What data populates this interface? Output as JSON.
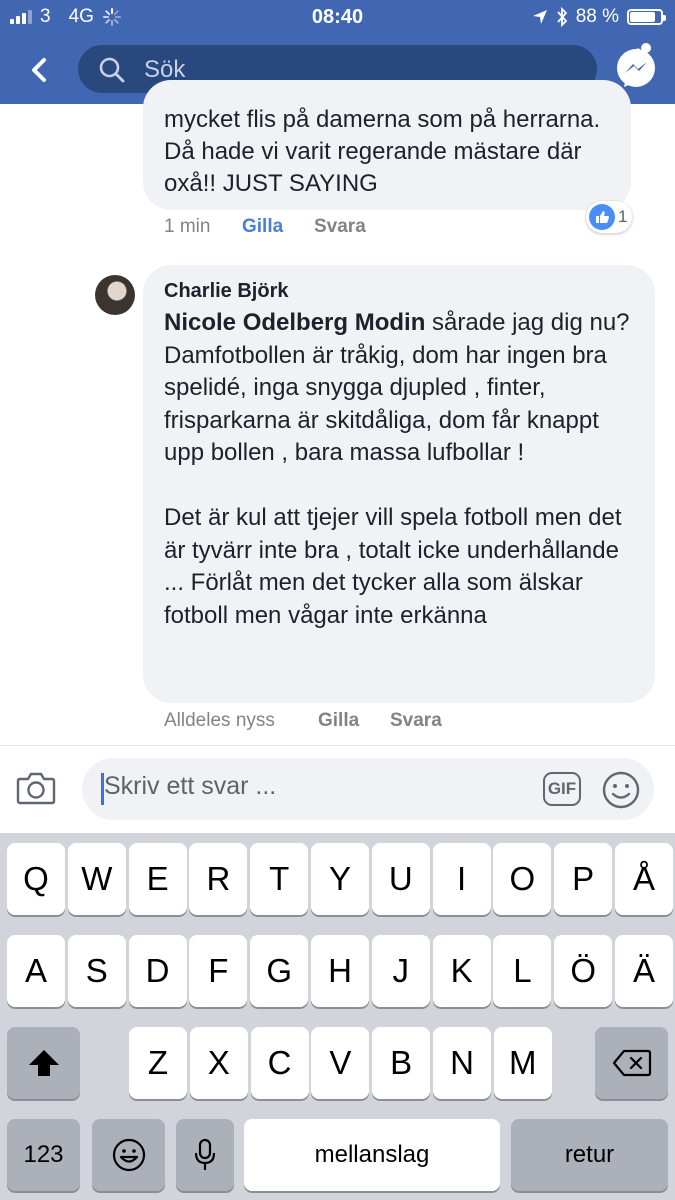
{
  "status_bar": {
    "carrier": "3",
    "network": "4G",
    "time": "08:40",
    "battery": "88 %",
    "battery_level": 0.88
  },
  "nav": {
    "search_placeholder": "Sök"
  },
  "comments": [
    {
      "text": "mycket flis på  damerna som på herrarna. Då hade vi varit regerande mästare där oxå!! JUST SAYING",
      "time": "1 min",
      "like_label": "Gilla",
      "reply_label": "Svara",
      "reaction_count": "1"
    },
    {
      "author": "Charlie Björk",
      "mention": "Nicole Odelberg Modin",
      "text": " sårade jag dig nu? Damfotbollen är tråkig, dom har ingen bra spelidé, inga snygga djupled , finter, frisparkarna är skitdåliga, dom får knappt upp bollen , bara massa lufbollar !",
      "text2": "Det är kul att tjejer vill spela fotboll men det är tyvärr inte bra , totalt icke underhållande ... Förlåt men det tycker alla som älskar fotboll men vågar inte erkänna",
      "time": "Alldeles nyss",
      "like_label": "Gilla",
      "reply_label": "Svara"
    }
  ],
  "reply_bar": {
    "placeholder": "Skriv ett svar ...",
    "gif_label": "GIF"
  },
  "keyboard": {
    "row1": [
      "Q",
      "W",
      "E",
      "R",
      "T",
      "Y",
      "U",
      "I",
      "O",
      "P",
      "Å"
    ],
    "row2": [
      "A",
      "S",
      "D",
      "F",
      "G",
      "H",
      "J",
      "K",
      "L",
      "Ö",
      "Ä"
    ],
    "row3": [
      "Z",
      "X",
      "C",
      "V",
      "B",
      "N",
      "M"
    ],
    "numbers_label": "123",
    "space_label": "mellanslag",
    "return_label": "retur"
  }
}
